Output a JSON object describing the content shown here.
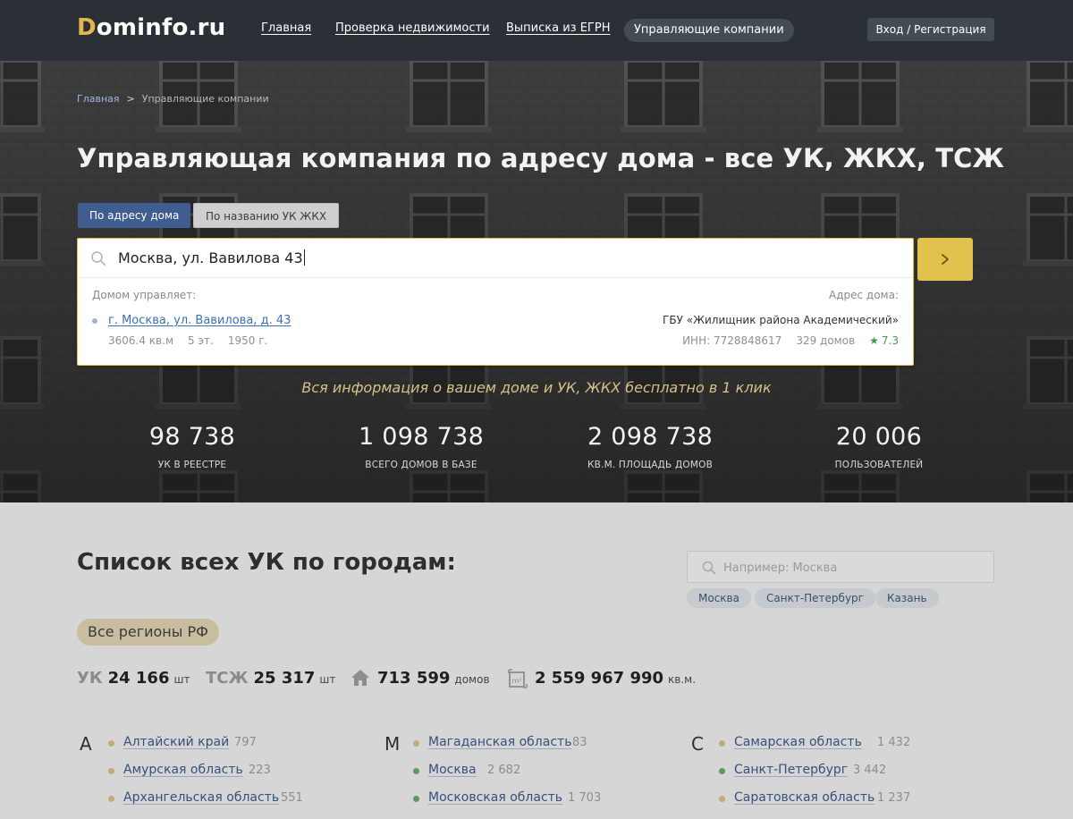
{
  "header": {
    "logo_first": "D",
    "logo_rest": "ominfo.ru",
    "nav": [
      {
        "label": "Главная"
      },
      {
        "label": "Проверка недвижимости"
      },
      {
        "label": "Выписка из ЕГРН"
      }
    ],
    "nav_active": "Управляющие компании",
    "login": "Вход / Регистрация"
  },
  "hero": {
    "breadcrumb": {
      "home": "Главная",
      "separator": ">",
      "current": "Управляющие компании"
    },
    "title": "Управляющая компания по адресу дома - все УК, ЖКХ, ТСЖ",
    "tabs": {
      "active": "По адресу дома",
      "inactive": "По названию УК ЖКХ"
    },
    "search": {
      "value": "Москва, ул. Вавилова 43",
      "label_left": "Домом управляет:",
      "label_right": "Адрес дома:",
      "suggestion": {
        "address": "г. Москва, ул. Вавилова, д. 43",
        "area": "3606.4 кв.м",
        "floors": "5 эт.",
        "year": "1950 г.",
        "company": "ГБУ «Жилищник района Академический»",
        "inn": "ИНН: 7728848617",
        "houses": "329 домов",
        "rating": "7.3"
      }
    },
    "tagline": "Вся информация о вашем доме и УК, ЖКХ бесплатно в 1 клик",
    "stats": [
      {
        "value": "98 738",
        "label": "УК в реестре"
      },
      {
        "value": "1 098 738",
        "label": "Всего домов в базе"
      },
      {
        "value": "2 098 738",
        "label": "кв.м. площадь домов"
      },
      {
        "value": "20 006",
        "label": "пользователей"
      }
    ]
  },
  "cities": {
    "title": "Список всех УК по городам:",
    "search_placeholder": "Например: Москва",
    "tags": [
      "Москва",
      "Санкт-Петербург",
      "Казань"
    ],
    "regions_filter": "Все регионы РФ",
    "totals": {
      "uk_label": "УК",
      "uk_value": "24 166",
      "uk_unit": "шт",
      "tsj_label": "ТСЖ",
      "tsj_value": "25 317",
      "tsj_unit": "шт",
      "houses_value": "713 599",
      "houses_unit": "домов",
      "area_value": "2 559 967 990",
      "area_unit": "кв.м."
    },
    "columns": [
      {
        "letter": "А",
        "items": [
          {
            "name": "Алтайский край",
            "count": "797",
            "dot": "#c2ab7a"
          },
          {
            "name": "Амурская область",
            "count": "223",
            "dot": "#c2ab7a"
          },
          {
            "name": "Архангельская область",
            "count": "551",
            "dot": "#c2ab7a"
          }
        ]
      },
      {
        "letter": "М",
        "items": [
          {
            "name": "Магаданская область",
            "count": "83",
            "dot": "#c2ab7a"
          },
          {
            "name": "Москва",
            "count": "2 682",
            "dot": "#5a9a5e"
          },
          {
            "name": "Московская область",
            "count": "1 703",
            "dot": "#5a9a5e"
          }
        ]
      },
      {
        "letter": "С",
        "items": [
          {
            "name": "Самарская область",
            "count": "1 432",
            "dot": "#c2ab7a"
          },
          {
            "name": "Санкт-Петербург",
            "count": "3 442",
            "dot": "#5a9a5e"
          },
          {
            "name": "Саратовская область",
            "count": "1 237",
            "dot": "#c2ab7a"
          }
        ]
      }
    ]
  },
  "colors": {
    "accent": "#e2c14f",
    "primary": "#3f5d91",
    "topbar": "#2b2f36"
  }
}
